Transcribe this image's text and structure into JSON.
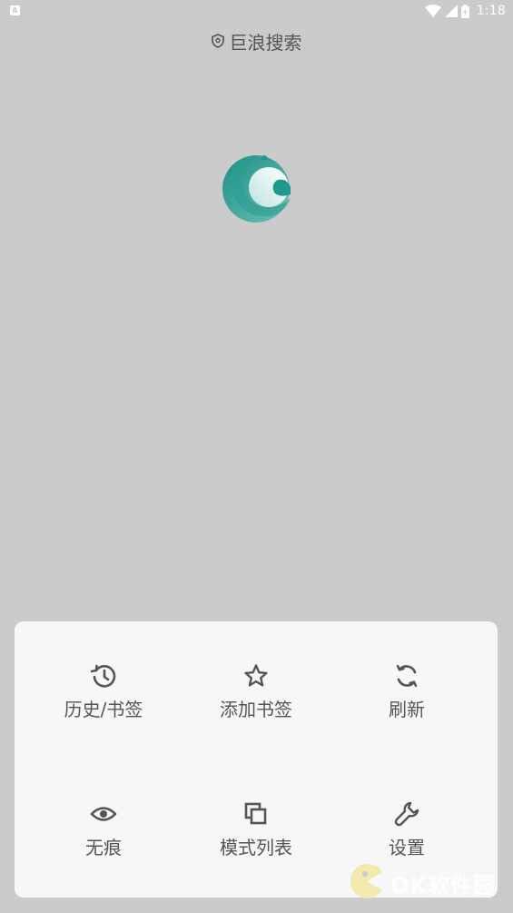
{
  "status_bar": {
    "notification_badge": "A",
    "time": "1:18",
    "icons": [
      "wifi-icon",
      "signal-icon",
      "battery-icon"
    ]
  },
  "header": {
    "shield_icon": "shield-icon",
    "title": "巨浪搜索"
  },
  "logo": {
    "icon": "app-logo"
  },
  "menu": {
    "items": [
      {
        "label": "历史/书签",
        "icon": "history-icon"
      },
      {
        "label": "添加书签",
        "icon": "star-icon"
      },
      {
        "label": "刷新",
        "icon": "refresh-icon"
      },
      {
        "label": "无痕",
        "icon": "eye-icon"
      },
      {
        "label": "模式列表",
        "icon": "layers-icon"
      },
      {
        "label": "设置",
        "icon": "wrench-icon"
      }
    ]
  },
  "watermark": {
    "text": "OK软件园"
  },
  "colors": {
    "background": "#cbcbcb",
    "sheet": "#f7f7f7",
    "text": "#555555",
    "logo_teal": "#1e9a8d"
  }
}
